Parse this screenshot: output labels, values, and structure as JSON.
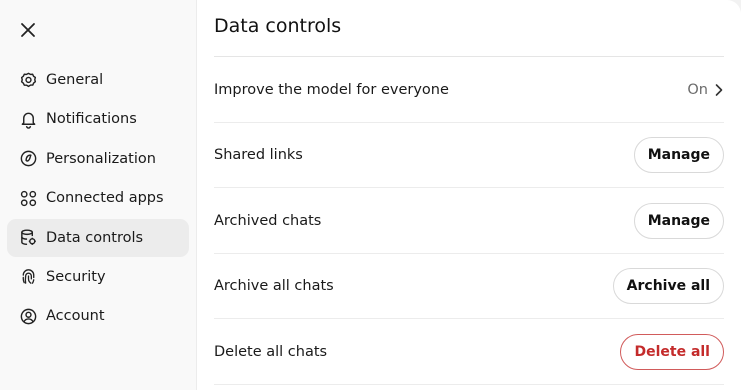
{
  "sidebar": {
    "items": [
      {
        "label": "General",
        "icon": "gear-icon"
      },
      {
        "label": "Notifications",
        "icon": "bell-icon"
      },
      {
        "label": "Personalization",
        "icon": "personalization-icon"
      },
      {
        "label": "Connected apps",
        "icon": "apps-icon"
      },
      {
        "label": "Data controls",
        "icon": "database-icon",
        "active": true
      },
      {
        "label": "Security",
        "icon": "fingerprint-icon"
      },
      {
        "label": "Account",
        "icon": "user-circle-icon"
      }
    ]
  },
  "main": {
    "title": "Data controls",
    "rows": [
      {
        "label": "Improve the model for everyone",
        "value": "On"
      },
      {
        "label": "Shared links",
        "button": "Manage"
      },
      {
        "label": "Archived chats",
        "button": "Manage"
      },
      {
        "label": "Archive all chats",
        "button": "Archive all"
      },
      {
        "label": "Delete all chats",
        "button": "Delete all",
        "danger": true
      }
    ]
  },
  "colors": {
    "danger": "#c42b2b",
    "sidebar_bg": "#f9f9f9",
    "active_bg": "#ececec"
  }
}
